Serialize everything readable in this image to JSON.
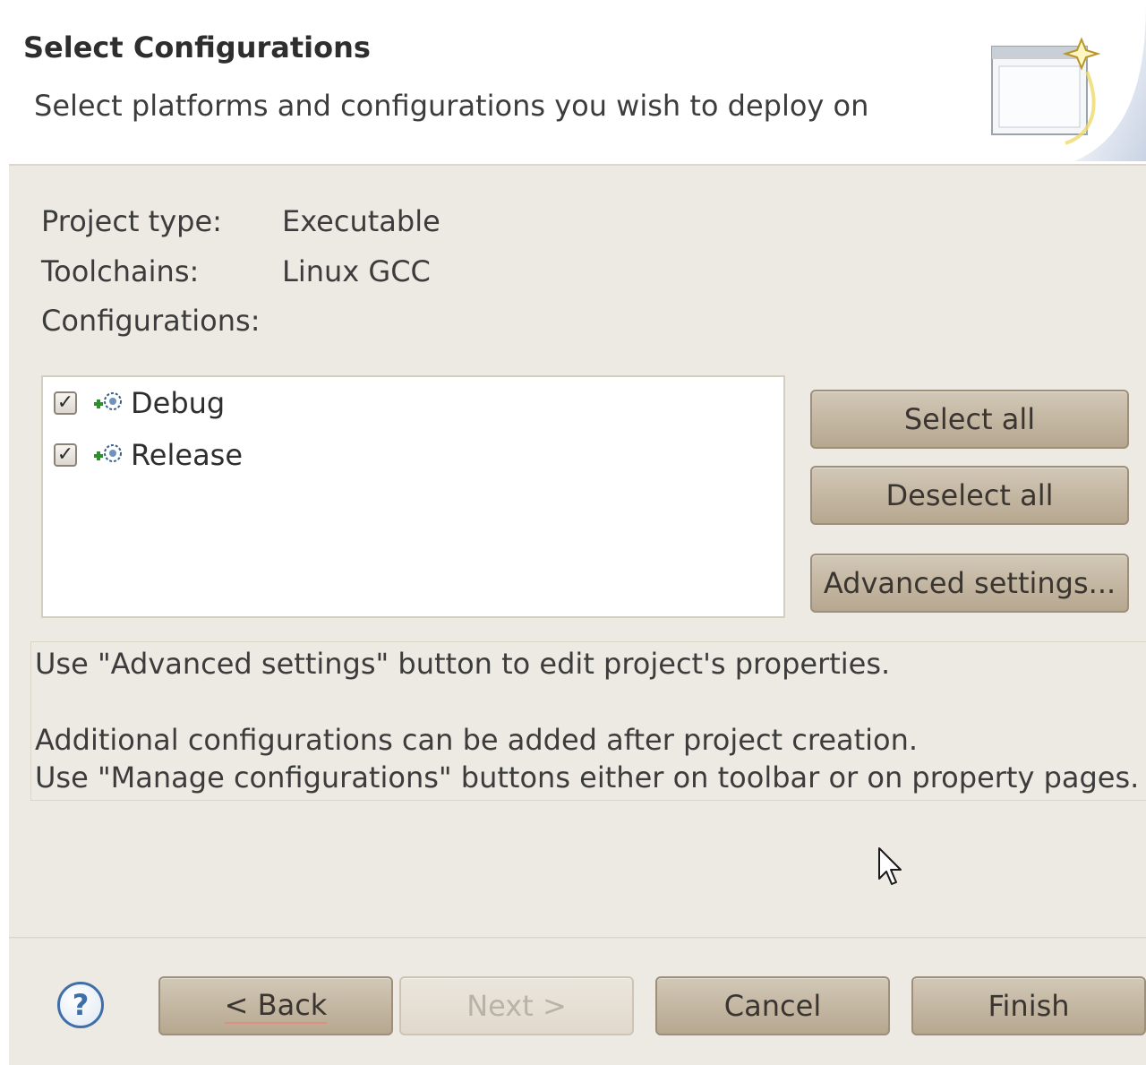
{
  "header": {
    "title": "Select Configurations",
    "description": "Select platforms and configurations you wish to deploy on"
  },
  "project_info": {
    "project_type_label": "Project type:",
    "project_type_value": "Executable",
    "toolchains_label": "Toolchains:",
    "toolchains_value": "Linux GCC",
    "configurations_label": "Configurations:"
  },
  "configurations": [
    {
      "label": "Debug",
      "checked": true,
      "check_glyph": "✓"
    },
    {
      "label": "Release",
      "checked": true,
      "check_glyph": "✓"
    }
  ],
  "side_buttons": {
    "select_all": "Select all",
    "deselect_all": "Deselect all",
    "advanced_settings": "Advanced settings..."
  },
  "hints": {
    "line1": "Use \"Advanced settings\" button to edit project's properties.",
    "line2": "Additional configurations can be added after project creation.",
    "line3": "Use \"Manage configurations\" buttons either on toolbar or on property pages."
  },
  "footer": {
    "help_glyph": "?",
    "back": "< Back",
    "next": "Next >",
    "cancel": "Cancel",
    "finish": "Finish"
  },
  "colors": {
    "panel_bg": "#ede9e3",
    "button_bg": "#c4b8a4",
    "help_blue": "#3e6fa8"
  }
}
